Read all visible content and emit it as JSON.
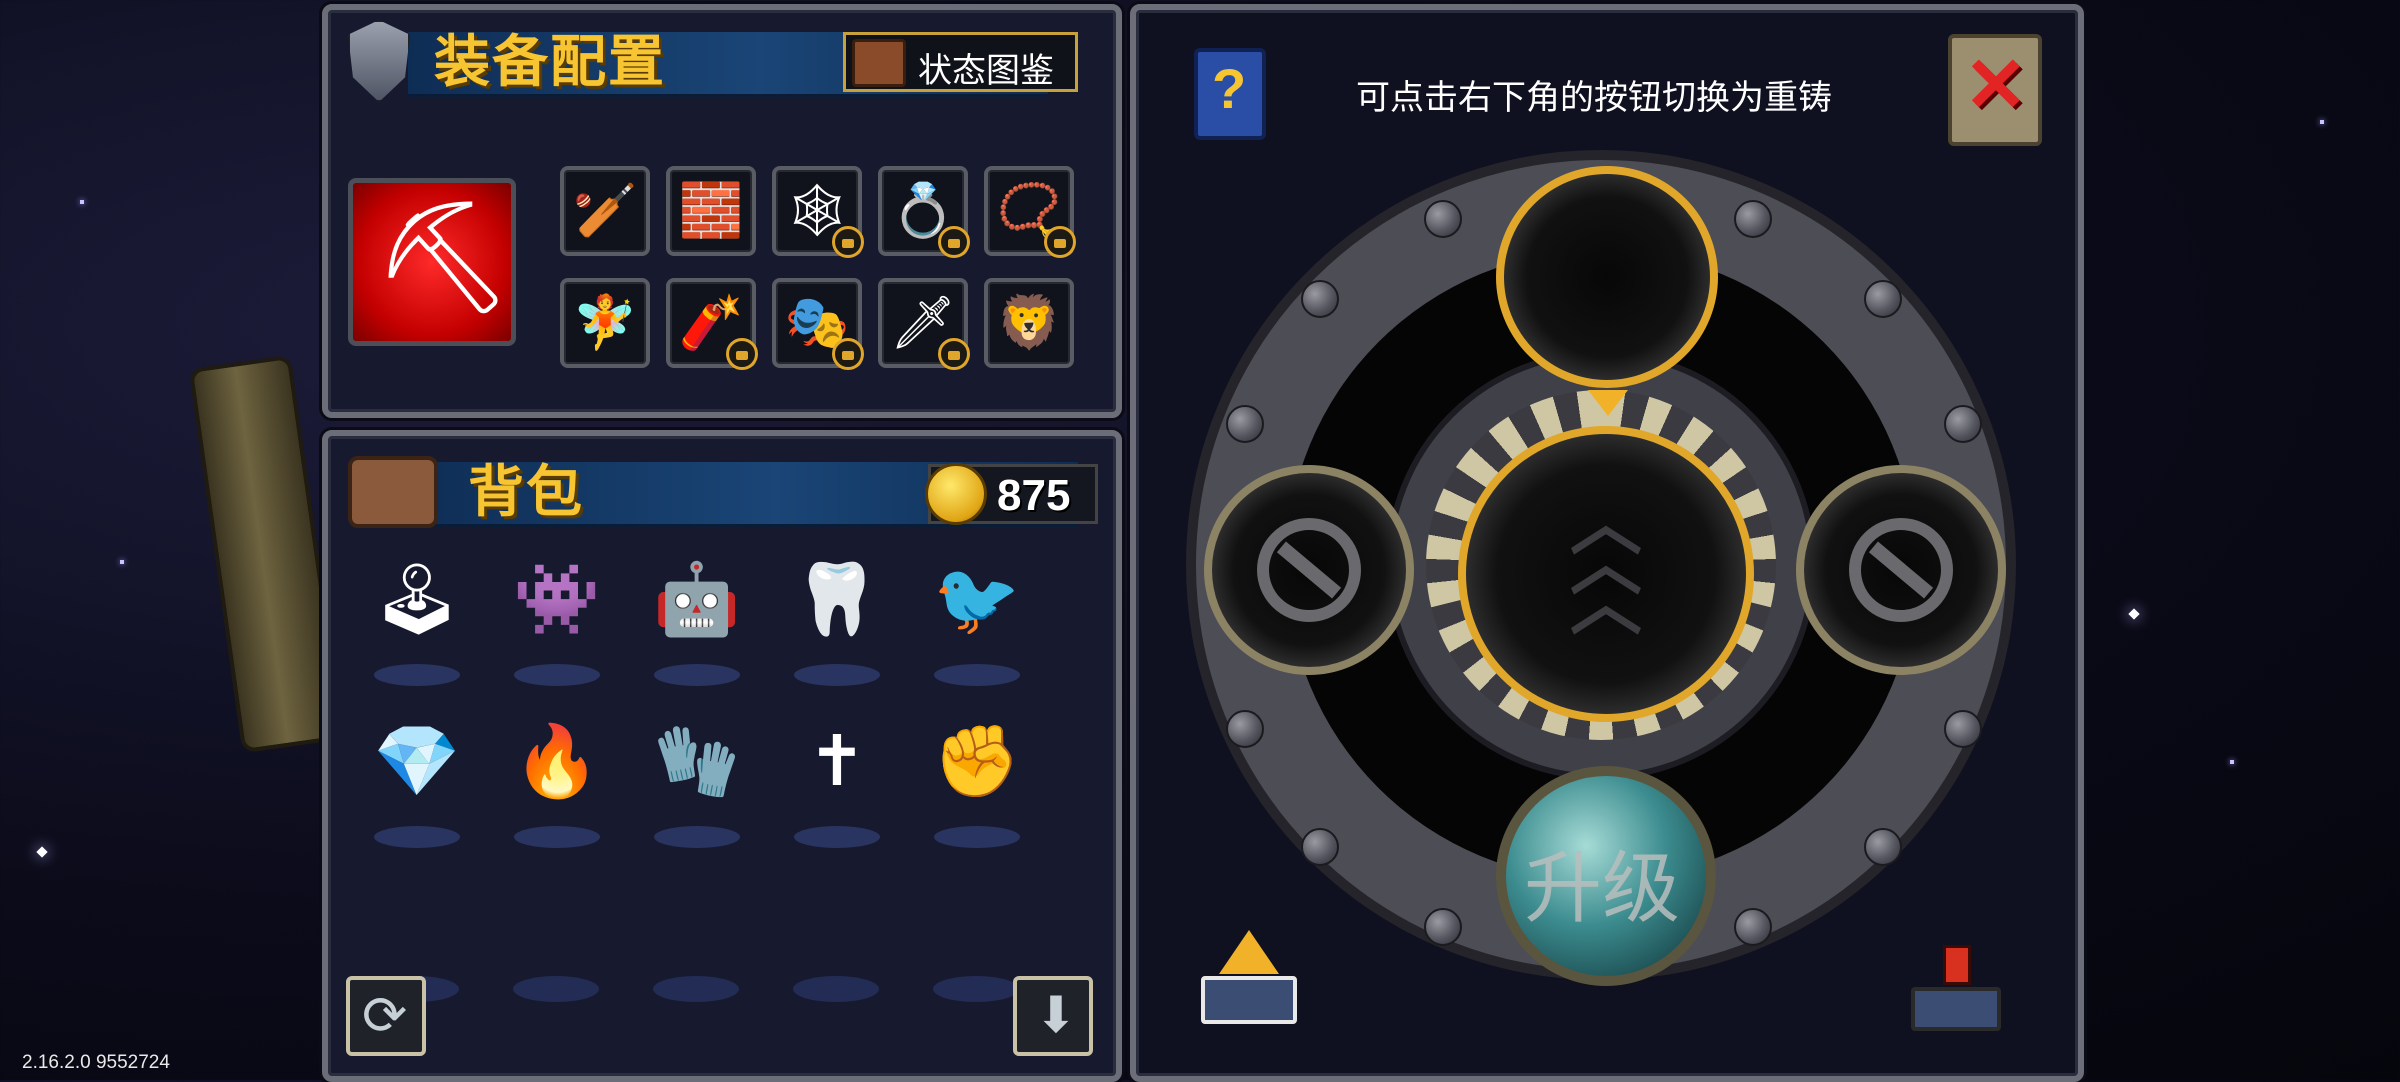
{
  "equipment": {
    "title": "装备配置",
    "status_button": "状态图鉴",
    "main_weapon_icon": "pickaxe-icon",
    "slots": [
      {
        "icon": "baseball-bat-icon",
        "glyph": "🏏",
        "locked": false
      },
      {
        "icon": "brick-icon",
        "glyph": "🧱",
        "locked": false
      },
      {
        "icon": "spiderweb-icon",
        "glyph": "🕸",
        "locked": true
      },
      {
        "icon": "blue-gem-ring-icon",
        "glyph": "💍",
        "locked": true
      },
      {
        "icon": "pink-bracelet-icon",
        "glyph": "📿",
        "locked": true
      },
      {
        "icon": "fairy-icon",
        "glyph": "🧚",
        "locked": false
      },
      {
        "icon": "rocket-icon",
        "glyph": "🧨",
        "locked": true
      },
      {
        "icon": "tribal-mask-icon",
        "glyph": "🎭",
        "locked": true
      },
      {
        "icon": "sword-icon",
        "glyph": "🗡",
        "locked": true
      },
      {
        "icon": "lion-mane-icon",
        "glyph": "🦁",
        "locked": false
      }
    ]
  },
  "backpack": {
    "title": "背包",
    "coin_count": "875",
    "items": [
      {
        "icon": "arcade-machine-red-icon",
        "glyph": "🕹"
      },
      {
        "icon": "arcade-machine-skull-icon",
        "glyph": "👾"
      },
      {
        "icon": "robot-chest-icon",
        "glyph": "🤖"
      },
      {
        "icon": "fang-necklace-icon",
        "glyph": "🦷"
      },
      {
        "icon": "blue-bird-icon",
        "glyph": "🐦"
      },
      {
        "icon": "green-crystal-icon",
        "glyph": "💎"
      },
      {
        "icon": "fire-seahorse-icon",
        "glyph": "🔥"
      },
      {
        "icon": "golden-glove-icon",
        "glyph": "🧤"
      },
      {
        "icon": "rosary-icon",
        "glyph": "✝"
      },
      {
        "icon": "bronze-fist-icon",
        "glyph": "✊"
      }
    ]
  },
  "forge": {
    "hint_text": "可点击右下角的按钮切换为重铸",
    "upgrade_label": "升级"
  },
  "version": "2.16.2.0 9552724"
}
